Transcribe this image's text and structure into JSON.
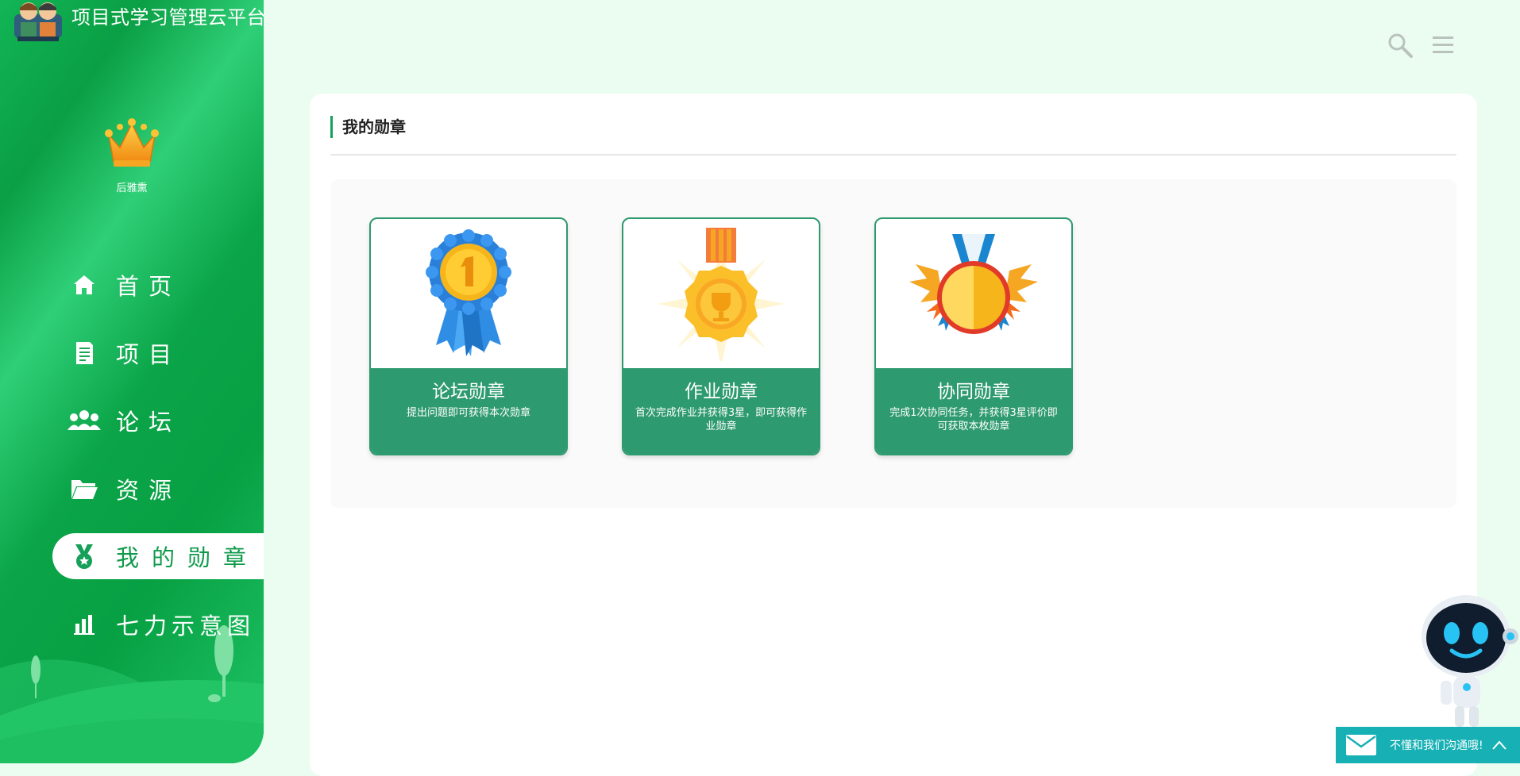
{
  "app": {
    "title": "项目式学习管理云平台"
  },
  "user": {
    "name": "后雅熏"
  },
  "sidebar": {
    "items": [
      {
        "label": "首页",
        "icon": "home-icon",
        "active": false
      },
      {
        "label": "项目",
        "icon": "document-icon",
        "active": false
      },
      {
        "label": "论坛",
        "icon": "users-icon",
        "active": false
      },
      {
        "label": "资源",
        "icon": "folder-icon",
        "active": false
      },
      {
        "label": "我的勋章",
        "icon": "medal-icon",
        "active": true
      },
      {
        "label": "七力示意图",
        "icon": "bar-chart-icon",
        "active": false
      }
    ]
  },
  "header": {
    "icons": [
      "search-icon",
      "menu-icon"
    ]
  },
  "main": {
    "section_title": "我的勋章",
    "badges": [
      {
        "name": "论坛勋章",
        "desc": "提出问题即可获得本次勋章",
        "icon": "rosette-medal-icon"
      },
      {
        "name": "作业勋章",
        "desc": "首次完成作业并获得3星，即可获得作业勋章",
        "icon": "gold-trophy-medal-icon"
      },
      {
        "name": "协同勋章",
        "desc": "完成1次协同任务，并获得3星评价即可获取本枚勋章",
        "icon": "winged-medal-icon"
      }
    ]
  },
  "contact": {
    "label": "不懂和我们沟通哦!"
  },
  "colors": {
    "brand_green": "#0fa34c",
    "badge_green": "#2e9a6f",
    "contact_teal": "#17b0b4"
  }
}
